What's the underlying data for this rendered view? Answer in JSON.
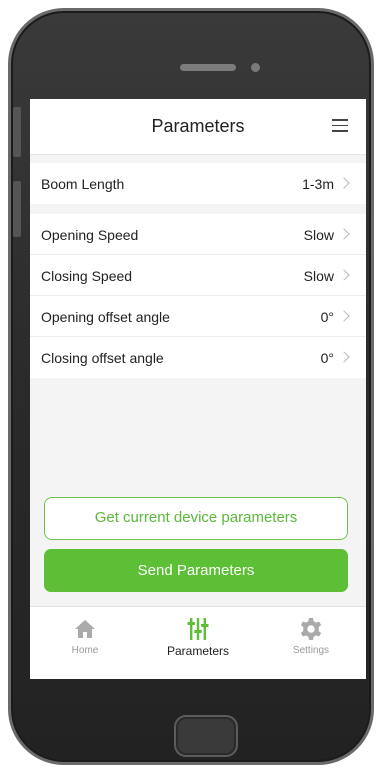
{
  "header": {
    "title": "Parameters",
    "menu_icon": "hamburger-menu-icon"
  },
  "groups": [
    {
      "rows": [
        {
          "label": "Boom Length",
          "value": "1-3m"
        }
      ]
    },
    {
      "rows": [
        {
          "label": "Opening Speed",
          "value": "Slow"
        },
        {
          "label": "Closing Speed",
          "value": "Slow"
        },
        {
          "label": "Opening offset angle",
          "value": "0°"
        },
        {
          "label": "Closing offset angle",
          "value": "0°"
        }
      ]
    }
  ],
  "actions": {
    "get_params_label": "Get current device parameters",
    "send_params_label": "Send Parameters"
  },
  "tabs": [
    {
      "label": "Home",
      "icon": "home-icon",
      "active": false
    },
    {
      "label": "Parameters",
      "icon": "sliders-icon",
      "active": true
    },
    {
      "label": "Settings",
      "icon": "gear-icon",
      "active": false
    }
  ],
  "colors": {
    "accent": "#5cbf35",
    "accent_text": "#5cb83a",
    "inactive_icon": "#aaaaaa"
  }
}
